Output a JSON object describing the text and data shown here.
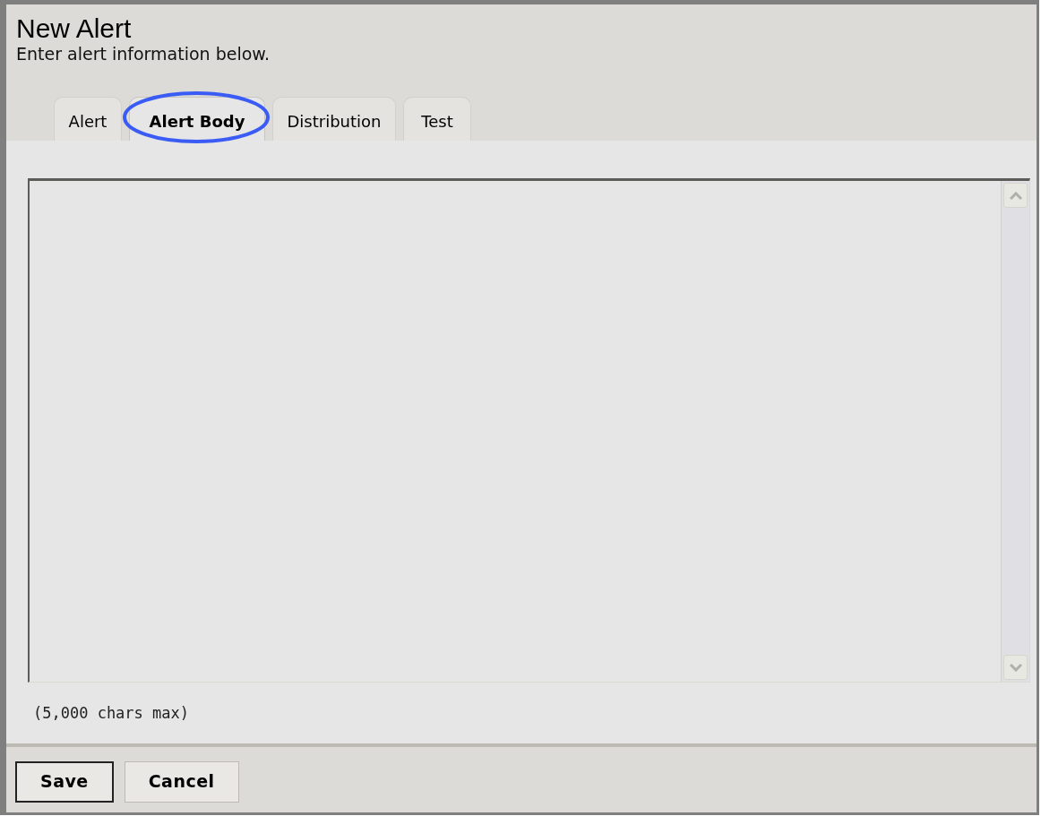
{
  "header": {
    "title": "New Alert",
    "subtitle": "Enter alert information below."
  },
  "tabs": [
    {
      "label": "Alert",
      "selected": false,
      "circled": false
    },
    {
      "label": "Alert Body",
      "selected": true,
      "circled": true
    },
    {
      "label": "Distribution",
      "selected": false,
      "circled": false
    },
    {
      "label": "Test",
      "selected": false,
      "circled": false
    }
  ],
  "char_limit": "(5,000 chars max)",
  "buttons": [
    {
      "label": "Save",
      "default": true
    },
    {
      "label": "Cancel",
      "default": false
    }
  ]
}
